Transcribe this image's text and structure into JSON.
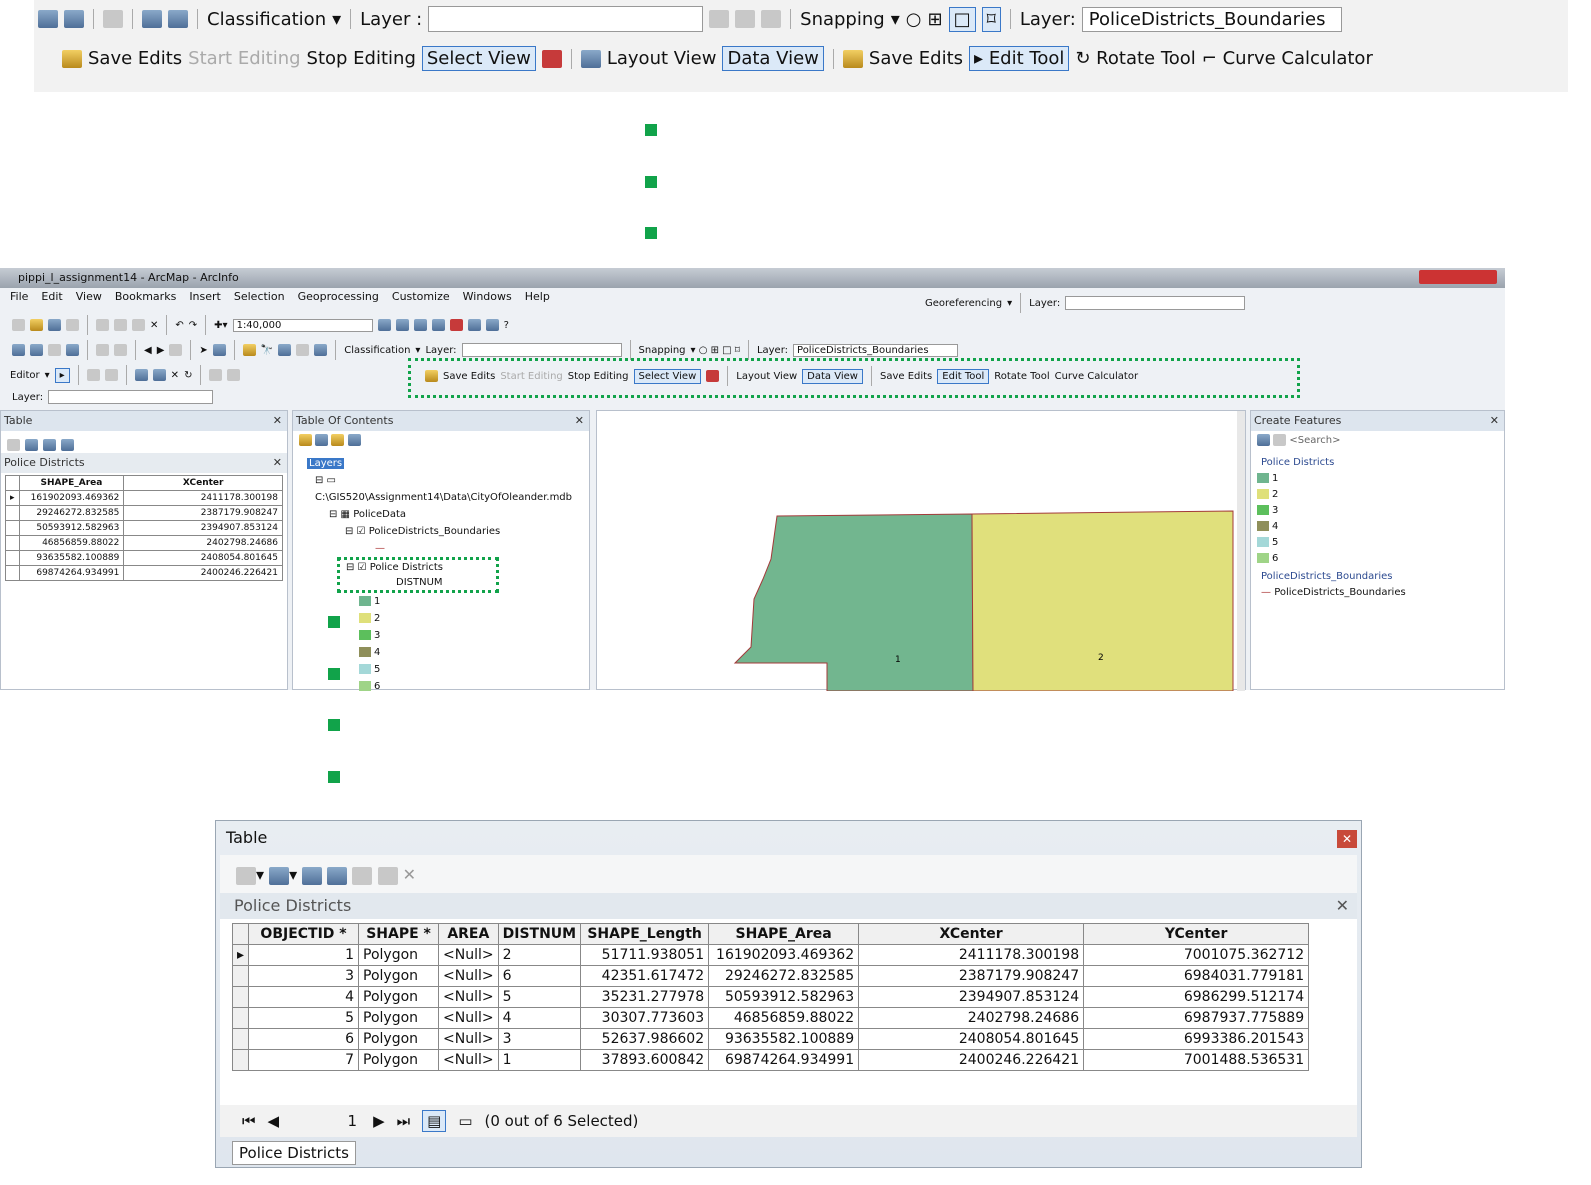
{
  "zoomed_toolbar": {
    "row1": {
      "classification": "Classification",
      "layer_label": "Layer :",
      "snapping": "Snapping",
      "layer2_label": "Layer:",
      "layer2_value": "PoliceDistricts_Boundaries"
    },
    "row2": {
      "save_edits": "Save Edits",
      "start_editing": "Start Editing",
      "stop_editing": "Stop Editing",
      "select_view": "Select View",
      "layout_view": "Layout View",
      "data_view": "Data View",
      "save_edits2": "Save Edits",
      "edit_tool": "Edit Tool",
      "rotate_tool": "Rotate Tool",
      "curve_calculator": "Curve Calculator"
    }
  },
  "arcmap": {
    "title": "pippi_l_assignment14 - ArcMap - ArcInfo",
    "menu": [
      "File",
      "Edit",
      "View",
      "Bookmarks",
      "Insert",
      "Selection",
      "Geoprocessing",
      "Customize",
      "Windows",
      "Help"
    ],
    "scale": "1:40,000",
    "georeferencing": "Georeferencing",
    "layer_label": "Layer:",
    "classification": "Classification",
    "snapping": "Snapping",
    "layer2_value": "PoliceDistricts_Boundaries",
    "editor": "Editor",
    "custom": {
      "save_edits": "Save Edits",
      "start_editing": "Start Editing",
      "stop_editing": "Stop Editing",
      "select_view": "Select View",
      "layout_view": "Layout View",
      "data_view": "Data View",
      "save_edits2": "Save Edits",
      "edit_tool": "Edit Tool",
      "rotate_tool": "Rotate Tool",
      "curve_calculator": "Curve Calculator"
    },
    "table_panel": {
      "title": "Table",
      "subtitle": "Police Districts",
      "columns": [
        "SHAPE_Area",
        "XCenter"
      ],
      "rows": [
        [
          "161902093.469362",
          "2411178.300198"
        ],
        [
          "29246272.832585",
          "2387179.908247"
        ],
        [
          "50593912.582963",
          "2394907.853124"
        ],
        [
          "46856859.88022",
          "2402798.24686"
        ],
        [
          "93635582.100889",
          "2408054.801645"
        ],
        [
          "69874264.934991",
          "2400246.226421"
        ]
      ]
    },
    "toc": {
      "title": "Table Of Contents",
      "layers": "Layers",
      "db": "C:\\GIS520\\Assignment14\\Data\\CityOfOleander.mdb",
      "dataset": "PoliceData",
      "layer1": "PoliceDistricts_Boundaries",
      "layer2": "Police Districts",
      "field": "DISTNUM",
      "classes": [
        {
          "label": "1",
          "color": "#6fb58f"
        },
        {
          "label": "2",
          "color": "#dfe07a"
        },
        {
          "label": "3",
          "color": "#5cbf5c"
        },
        {
          "label": "4",
          "color": "#8f8f5a"
        },
        {
          "label": "5",
          "color": "#a4d8d8"
        },
        {
          "label": "6",
          "color": "#9fd487"
        }
      ]
    },
    "map": {
      "labels": [
        "1",
        "2"
      ],
      "colors": {
        "district1": "#72b68f",
        "district2": "#e0e07c",
        "boundary": "#a33a3a"
      }
    },
    "create_features": {
      "title": "Create Features",
      "search_placeholder": "<Search>",
      "group1": "Police Districts",
      "group2": "PoliceDistricts_Boundaries",
      "template2": "PoliceDistricts_Boundaries"
    }
  },
  "table_window": {
    "title": "Table",
    "subtitle": "Police Districts",
    "columns": [
      "OBJECTID *",
      "SHAPE *",
      "AREA",
      "DISTNUM",
      "SHAPE_Length",
      "SHAPE_Area",
      "XCenter",
      "YCenter"
    ],
    "rows": [
      [
        "1",
        "Polygon",
        "<Null>",
        "2",
        "51711.938051",
        "161902093.469362",
        "2411178.300198",
        "7001075.362712"
      ],
      [
        "3",
        "Polygon",
        "<Null>",
        "6",
        "42351.617472",
        "29246272.832585",
        "2387179.908247",
        "6984031.779181"
      ],
      [
        "4",
        "Polygon",
        "<Null>",
        "5",
        "35231.277978",
        "50593912.582963",
        "2394907.853124",
        "6986299.512174"
      ],
      [
        "5",
        "Polygon",
        "<Null>",
        "4",
        "30307.773603",
        "46856859.88022",
        "2402798.24686",
        "6987937.775889"
      ],
      [
        "6",
        "Polygon",
        "<Null>",
        "3",
        "52637.986602",
        "93635582.100889",
        "2408054.801645",
        "6993386.201543"
      ],
      [
        "7",
        "Polygon",
        "<Null>",
        "1",
        "37893.600842",
        "69874264.934991",
        "2400246.226421",
        "7001488.536531"
      ]
    ],
    "record": "1",
    "selection_status": "(0 out of 6 Selected)",
    "tab": "Police Districts"
  }
}
